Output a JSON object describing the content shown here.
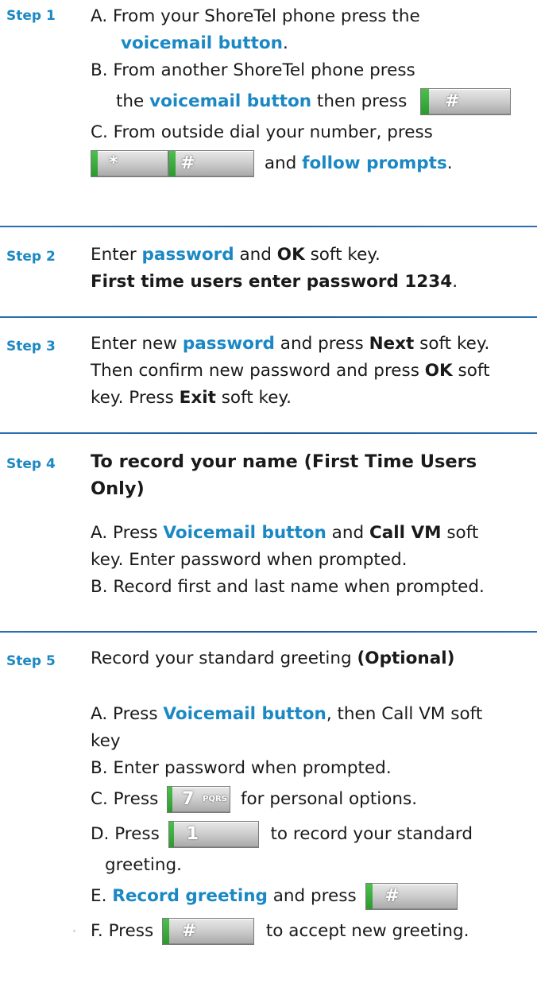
{
  "steps": [
    {
      "label": "Step 1",
      "lines": {
        "a_prefix": "A. From your ShoreTel phone press the",
        "a_hl": "voicemail button",
        "a_end": ".",
        "b_prefix": "B. From another ShoreTel phone press",
        "b2_pre": "the ",
        "b2_hl": "voicemail button",
        "b2_mid": " then press",
        "c_prefix": "C. From outside dial your number, press",
        "c2_mid": "and ",
        "c2_hl": "follow prompts",
        "c2_end": "."
      },
      "keys": {
        "hash": "#",
        "star": "*"
      }
    },
    {
      "label": "Step 2",
      "lines": {
        "l1_pre": "Enter ",
        "l1_hl": "password",
        "l1_mid": " and ",
        "l1_b": "OK",
        "l1_end": " soft key.",
        "l2_b": "First time users enter password 1234",
        "l2_end": "."
      }
    },
    {
      "label": "Step 3",
      "lines": {
        "l1_pre": "Enter new ",
        "l1_hl": "password",
        "l1_mid": " and press ",
        "l1_b": "Next",
        "l1_end": " soft key.",
        "l2_pre": "Then confirm new password and press ",
        "l2_b": "OK",
        "l2_end": " soft",
        "l3_pre": "key. Press ",
        "l3_b": "Exit",
        "l3_end": " soft key."
      }
    },
    {
      "label": "Step 4",
      "lines": {
        "h1": "To record your name (First Time Users",
        "h2": "Only)",
        "a_pre": "A. Press ",
        "a_hl": "Voicemail button",
        "a_mid": " and ",
        "a_b": "Call VM",
        "a_end": " soft",
        "a2": "key. Enter password when prompted.",
        "b": "B. Record first and last name when prompted."
      }
    },
    {
      "label": "Step 5",
      "lines": {
        "h_pre": "Record your standard greeting ",
        "h_b": "(Optional)",
        "a_pre": "A. Press ",
        "a_hl": "Voicemail button",
        "a_end": ", then Call VM soft",
        "a2": "key",
        "b": "B. Enter password when prompted.",
        "c_pre": "C. Press",
        "c_end": "for personal options.",
        "d_pre": "D. Press",
        "d_end": "to record your standard",
        "d2": "greeting.",
        "e_hl": "Record greeting",
        "e_pre": "E. ",
        "e_end": " and press",
        "f_pre": "F. Press",
        "f_end": "to accept new greeting."
      },
      "keys": {
        "seven": "7",
        "seven_sub": "PQRS",
        "one": "1",
        "hash": "#"
      }
    }
  ],
  "colors": {
    "highlight": "#1b88c4",
    "divider": "#1a5a97",
    "key_accent": "#2b9a2d"
  }
}
